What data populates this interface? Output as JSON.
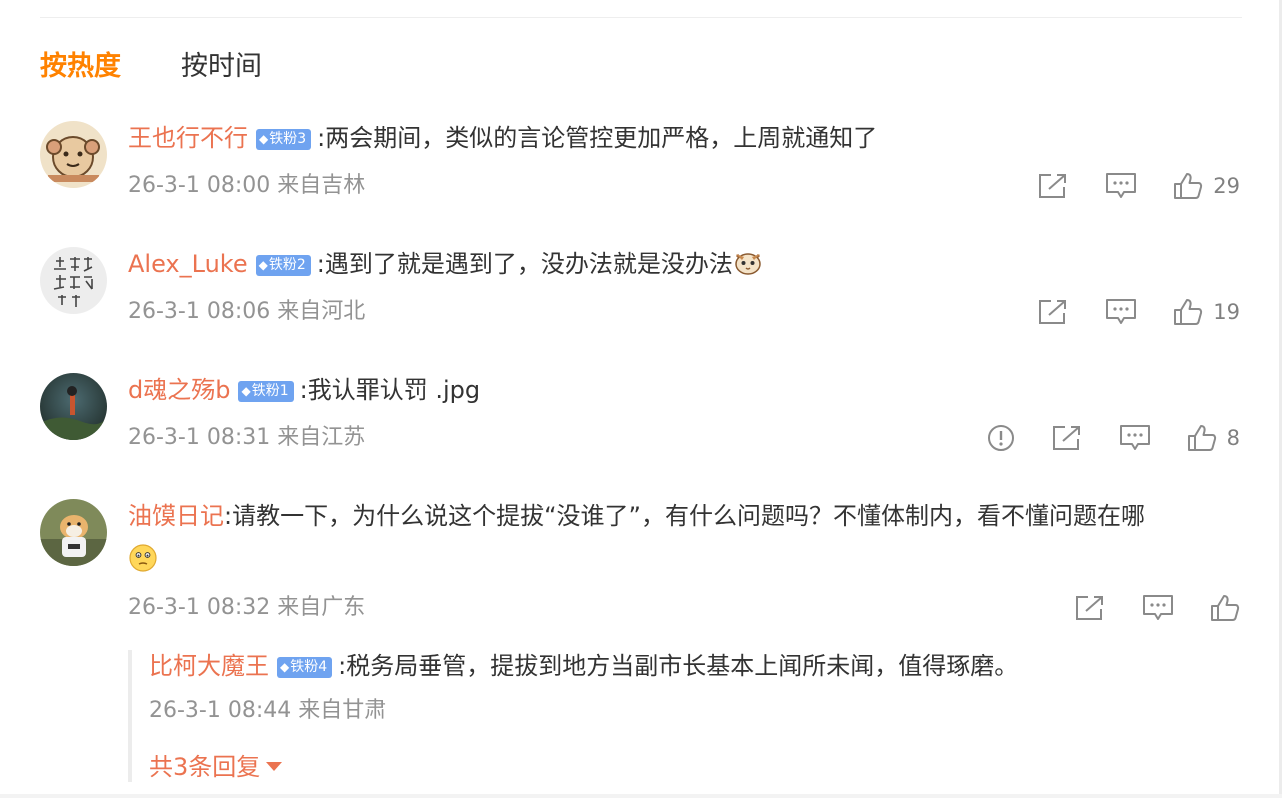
{
  "tabs": [
    {
      "label": "按热度",
      "active": true
    },
    {
      "label": "按时间",
      "active": false
    }
  ],
  "comments": [
    {
      "user": "王也行不行",
      "badge": "铁粉3",
      "text": "两会期间，类似的言论管控更加严格，上周就通知了",
      "meta": "26-3-1 08:00 来自吉林",
      "likes": "29"
    },
    {
      "user": "Alex_Luke",
      "badge": "铁粉2",
      "text": "遇到了就是遇到了，没办法就是没办法",
      "emoji": "cat-emoji",
      "meta": "26-3-1 08:06 来自河北",
      "likes": "19"
    },
    {
      "user": "d魂之殇b",
      "badge": "铁粉1",
      "text": "我认罪认罚 .jpg",
      "meta": "26-3-1 08:31 来自江苏",
      "likes": "8",
      "has_report": true
    },
    {
      "user": "油馍日记",
      "text": "请教一下，为什么说这个提拔“没谁了”，有什么问题吗？不懂体制内，看不懂问题在哪",
      "emoji": "thinking-face-emoji",
      "meta": "26-3-1 08:32 来自广东",
      "likes": ""
    }
  ],
  "reply": {
    "user": "比柯大魔王",
    "badge": "铁粉4",
    "text": "税务局垂管，提拔到地方当副市长基本上闻所未闻，值得琢磨。",
    "meta": "26-3-1 08:44 来自甘肃",
    "more_label": "共3条回复"
  },
  "colors": {
    "accent": "#ff8200",
    "username": "#eb7350",
    "badge": "#6fa3f0",
    "meta": "#939393",
    "icon": "#8a8a8a"
  },
  "icons": [
    "share-icon",
    "comment-icon",
    "like-icon",
    "report-icon",
    "caret-down-icon"
  ]
}
